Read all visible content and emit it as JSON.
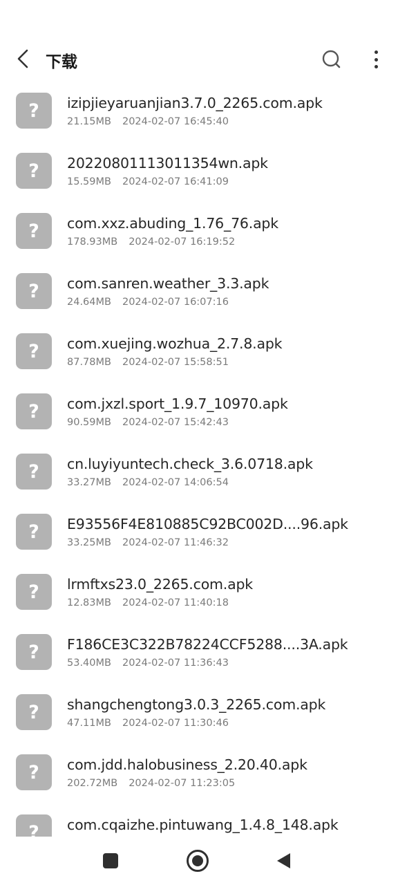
{
  "header": {
    "title": "下载",
    "icons": {
      "back": "back-arrow-icon",
      "search": "search-icon",
      "more": "more-vertical-icon"
    }
  },
  "files": [
    {
      "name": "izipjieyaruanjian3.7.0_2265.com.apk",
      "size": "21.15MB",
      "date": "2024-02-07 16:45:40"
    },
    {
      "name": "20220801113011354wn.apk",
      "size": "15.59MB",
      "date": "2024-02-07 16:41:09"
    },
    {
      "name": "com.xxz.abuding_1.76_76.apk",
      "size": "178.93MB",
      "date": "2024-02-07 16:19:52"
    },
    {
      "name": "com.sanren.weather_3.3.apk",
      "size": "24.64MB",
      "date": "2024-02-07 16:07:16"
    },
    {
      "name": "com.xuejing.wozhua_2.7.8.apk",
      "size": "87.78MB",
      "date": "2024-02-07 15:58:51"
    },
    {
      "name": "com.jxzl.sport_1.9.7_10970.apk",
      "size": "90.59MB",
      "date": "2024-02-07 15:42:43"
    },
    {
      "name": "cn.luyiyuntech.check_3.6.0718.apk",
      "size": "33.27MB",
      "date": "2024-02-07 14:06:54"
    },
    {
      "name": "E93556F4E810885C92BC002D....96.apk",
      "size": "33.25MB",
      "date": "2024-02-07 11:46:32"
    },
    {
      "name": "lrmftxs23.0_2265.com.apk",
      "size": "12.83MB",
      "date": "2024-02-07 11:40:18"
    },
    {
      "name": "F186CE3C322B78224CCF5288....3A.apk",
      "size": "53.40MB",
      "date": "2024-02-07 11:36:43"
    },
    {
      "name": "shangchengtong3.0.3_2265.com.apk",
      "size": "47.11MB",
      "date": "2024-02-07 11:30:46"
    },
    {
      "name": "com.jdd.halobusiness_2.20.40.apk",
      "size": "202.72MB",
      "date": "2024-02-07 11:23:05"
    },
    {
      "name": "com.cqaizhe.pintuwang_1.4.8_148.apk",
      "size": "",
      "date": ""
    }
  ],
  "file_icon": {
    "glyph": "?",
    "name": "unknown-file-icon",
    "color": "#b3b3b3"
  },
  "navigation_bar": {
    "icons": [
      "recents-square-icon",
      "home-circle-icon",
      "back-triangle-icon"
    ]
  }
}
